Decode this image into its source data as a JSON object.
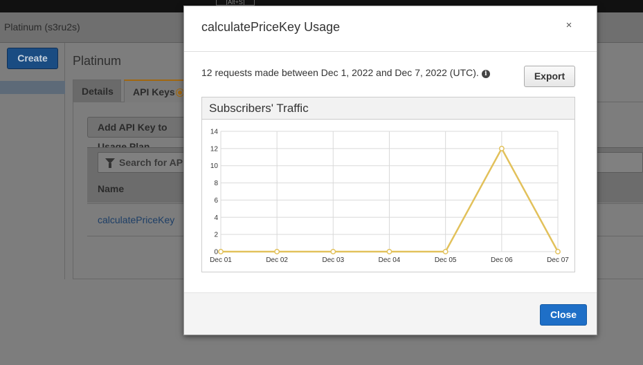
{
  "background": {
    "top_hint": "[Alt+S]",
    "window_title": "Platinum (s3ru2s)",
    "create_label": "Create",
    "plan_heading": "Platinum",
    "tabs": [
      {
        "label": "Details"
      },
      {
        "label": "API Keys"
      }
    ],
    "add_key_label": "Add API Key to Usage Plan",
    "search_placeholder": "Search for API Keys",
    "column_name": "Name",
    "key_name": "calculatePriceKey"
  },
  "modal": {
    "title": "calculatePriceKey Usage",
    "close_symbol": "×",
    "summary": "12 requests made between Dec 1, 2022 and Dec 7, 2022 (UTC).",
    "info_symbol": "i",
    "export_label": "Export",
    "chart_title": "Subscribers' Traffic",
    "close_label": "Close"
  },
  "colors": {
    "line": "#e2c15b",
    "primary_button": "#1e6fc7"
  },
  "chart_data": {
    "type": "line",
    "title": "Subscribers' Traffic",
    "categories": [
      "Dec 01",
      "Dec 02",
      "Dec 03",
      "Dec 04",
      "Dec 05",
      "Dec 06",
      "Dec 07"
    ],
    "series": [
      {
        "values": [
          0,
          0,
          0,
          0,
          0,
          12,
          0
        ]
      }
    ],
    "yticks": [
      0,
      2,
      4,
      6,
      8,
      10,
      12,
      14
    ],
    "ylim": [
      0,
      14
    ],
    "grid": true,
    "legend": "none"
  }
}
